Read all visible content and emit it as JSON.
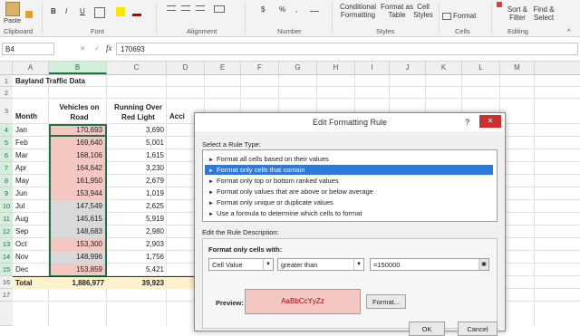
{
  "ribbon": {
    "paste_label": "Paste",
    "groups": {
      "clipboard": "Clipboard",
      "font": "Font",
      "alignment": "Alignment",
      "number": "Number",
      "styles": "Styles",
      "cells": "Cells",
      "editing": "Editing"
    },
    "font_buttons": [
      "B",
      "I",
      "U"
    ],
    "number_buttons": [
      "$",
      "%",
      ","
    ],
    "styles_buttons": {
      "conditional_line1": "Conditional",
      "conditional_line2": "Formatting",
      "format_table_line1": "Format as",
      "format_table_line2": "Table",
      "cell_styles_line1": "Cell",
      "cell_styles_line2": "Styles"
    },
    "cells_format": "Format",
    "editing_buttons": {
      "sort_line1": "Sort &",
      "sort_line2": "Filter",
      "find_line1": "Find &",
      "find_line2": "Select"
    }
  },
  "formula_bar": {
    "name_box": "B4",
    "cancel_symbol": "✕",
    "enter_symbol": "✓",
    "fx_symbol": "fx",
    "value": "170693"
  },
  "columns": [
    "A",
    "B",
    "C",
    "D",
    "E",
    "F",
    "G",
    "H",
    "I",
    "J",
    "K",
    "L",
    "M"
  ],
  "rows": [
    "1",
    "2",
    "3",
    "4",
    "5",
    "6",
    "7",
    "8",
    "9",
    "10",
    "11",
    "12",
    "13",
    "14",
    "15",
    "16",
    "17"
  ],
  "sheet": {
    "title": "Bayland Traffic Data",
    "header_month": "Month",
    "header_vehicles_line1": "Vehicles on",
    "header_vehicles_line2": "Road",
    "header_running_line1": "Running Over",
    "header_running_line2": "Red Light",
    "header_d_partial": "Acci",
    "data": [
      {
        "month": "Jan",
        "vehicles": "170,693",
        "red": "3,690",
        "highlight": true
      },
      {
        "month": "Feb",
        "vehicles": "169,640",
        "red": "5,001",
        "highlight": true
      },
      {
        "month": "Mar",
        "vehicles": "168,106",
        "red": "1,615",
        "highlight": true
      },
      {
        "month": "Apr",
        "vehicles": "164,642",
        "red": "3,230",
        "highlight": true
      },
      {
        "month": "May",
        "vehicles": "161,950",
        "red": "2,679",
        "highlight": true
      },
      {
        "month": "Jun",
        "vehicles": "153,944",
        "red": "1,019",
        "highlight": true
      },
      {
        "month": "Jul",
        "vehicles": "147,549",
        "red": "2,625",
        "highlight": false
      },
      {
        "month": "Aug",
        "vehicles": "145,615",
        "red": "5,919",
        "highlight": false
      },
      {
        "month": "Sep",
        "vehicles": "148,683",
        "red": "2,980",
        "highlight": false
      },
      {
        "month": "Oct",
        "vehicles": "153,300",
        "red": "2,903",
        "highlight": true
      },
      {
        "month": "Nov",
        "vehicles": "148,996",
        "red": "1,756",
        "highlight": false
      },
      {
        "month": "Dec",
        "vehicles": "153,859",
        "red": "5,421",
        "highlight": true
      }
    ],
    "total_label": "Total",
    "total_vehicles": "1,886,977",
    "total_red": "39,923"
  },
  "colors": {
    "highlight_fill": "#f4c7c3",
    "selected_fill": "#d9d9d9",
    "total_fill": "#fff2cc",
    "accent_green": "#217346",
    "rule_selected": "#2f7ad6"
  },
  "dialog": {
    "title": "Edit Formatting Rule",
    "help": "?",
    "close": "✕",
    "select_rule_type_label": "Select a Rule Type:",
    "rule_types": [
      {
        "label": "Format all cells based on their values",
        "selected": false
      },
      {
        "label": "Format only cells that contain",
        "selected": true
      },
      {
        "label": "Format only top or bottom ranked values",
        "selected": false
      },
      {
        "label": "Format only values that are above or below average",
        "selected": false
      },
      {
        "label": "Format only unique or duplicate values",
        "selected": false
      },
      {
        "label": "Use a formula to determine which cells to format",
        "selected": false
      }
    ],
    "edit_desc_label": "Edit the Rule Description:",
    "format_only_label": "Format only cells with:",
    "condition_field": "Cell Value",
    "operator_field": "greater than",
    "value_field": "=150000",
    "preview_label": "Preview:",
    "preview_text": "AaBbCcYyZz",
    "format_button": "Format...",
    "ok_button": "OK",
    "cancel_button": "Cancel"
  }
}
